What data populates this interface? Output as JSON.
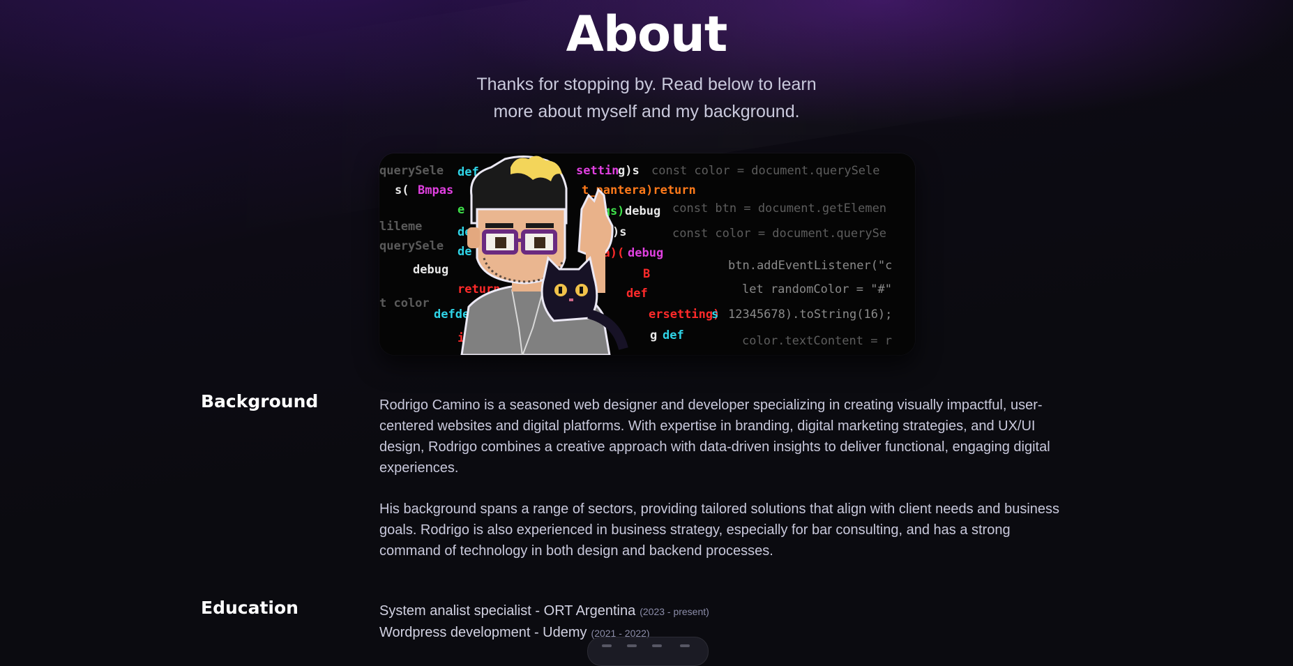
{
  "header": {
    "title": "About",
    "subtitle_line1": "Thanks for stopping by. Read below to learn",
    "subtitle_line2": "more about myself and my background."
  },
  "hero_image": {
    "description_icon": "pixel-art-developer-with-cat-icon",
    "code_lines_left": [
      "querySele",
      "s(",
      "def",
      "querySele",
      "debug",
      "defde",
      "t color"
    ],
    "code_lines_right": [
      "const color = document.querySele",
      "const btn = document.getElemen",
      "const color = document.querySe",
      "btn.addEventListener(\"c",
      "let randomColor = \"#\"",
      "12345678).toString(16);",
      "color.textContent = r"
    ],
    "code_keywords": [
      "def",
      "setting)s",
      "t_pantera)return",
      "tings) debug",
      "era)(debug",
      "return",
      "def",
      "ersetting)s",
      "g def"
    ]
  },
  "background": {
    "heading": "Background",
    "paragraph1_lines": [
      "Rodrigo Camino is a seasoned web designer and developer specializing in creating visually impactful, user-",
      "centered websites and digital platforms. With expertise in branding, digital marketing strategies, and UX/UI",
      "design, Rodrigo combines a creative approach with data-driven insights to deliver functional, engaging digital",
      "experiences."
    ],
    "paragraph2_lines": [
      "His background spans a range of sectors, providing tailored solutions that align with client needs and business",
      "goals. Rodrigo is also experienced in business strategy, especially for bar consulting, and has a strong",
      "command of technology in both design and backend processes."
    ]
  },
  "education": {
    "heading": "Education",
    "items": [
      {
        "title": "System analist specialist - ORT Argentina",
        "years": "(2023 - present)"
      },
      {
        "title": "Wordpress development - Udemy",
        "years": "(2021 - 2022)"
      }
    ]
  },
  "colors": {
    "background": "#0b0b10",
    "gradient_purple": "#2a1250",
    "heading": "#ffffff",
    "body_text": "#c9c9dc",
    "muted": "#8b8ca8",
    "code_cyan": "#2fd3e6",
    "code_magenta": "#e040e0",
    "code_red": "#ff2a2a",
    "code_green": "#3ee04a",
    "code_orange": "#ff7a1a",
    "code_gray": "#5d5d5d"
  }
}
